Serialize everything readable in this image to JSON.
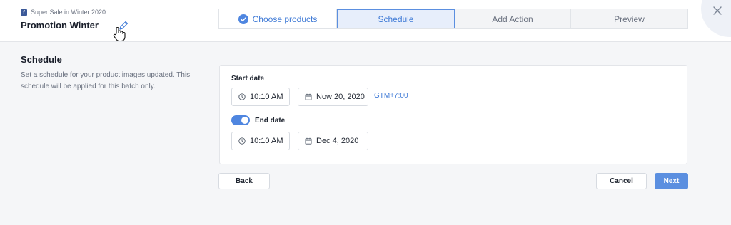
{
  "header": {
    "subtitle": "Super Sale in Winter 2020",
    "fb_icon_glyph": "f",
    "campaign_name": "Promotion Winter",
    "edit_icon": "pencil-icon",
    "cursor_icon": "hand-pointer-icon",
    "close_icon": "close-icon"
  },
  "steps": [
    {
      "label": "Choose products",
      "state": "completed",
      "icon": "check-circle-icon"
    },
    {
      "label": "Schedule",
      "state": "active"
    },
    {
      "label": "Add Action",
      "state": "pending"
    },
    {
      "label": "Preview",
      "state": "pending"
    }
  ],
  "section": {
    "title": "Schedule",
    "description": "Set a schedule for your product images updated. This schedule will be applied for this batch only."
  },
  "start": {
    "label": "Start date",
    "time": "10:10 AM",
    "date": "Now 20, 2020",
    "timezone": "GTM+7:00"
  },
  "end": {
    "label": "End date",
    "enabled": true,
    "time": "10:10 AM",
    "date": "Dec 4, 2020"
  },
  "actions": {
    "back": "Back",
    "cancel": "Cancel",
    "next": "Next"
  },
  "colors": {
    "accent": "#5b8fe0",
    "link": "#3f7ad6",
    "facebook": "#3b5998"
  }
}
